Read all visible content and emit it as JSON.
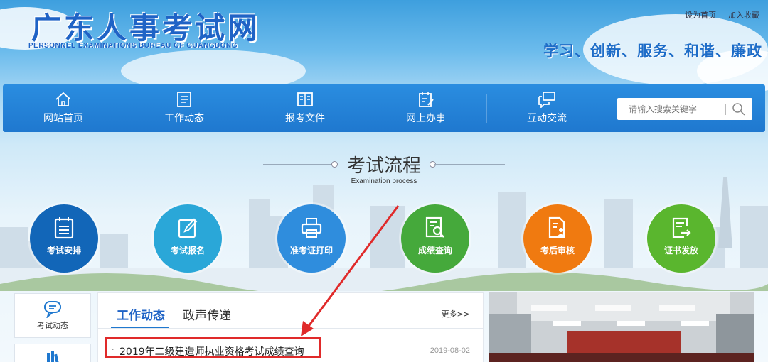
{
  "header": {
    "title": "广东人事考试网",
    "subtitle": "PERSONNEL EXAMINATIONS BUREAU OF GUANGDONG",
    "links": [
      "设为首页",
      "加入收藏"
    ],
    "slogan": "学习、创新、服务、和谐、廉政"
  },
  "nav": {
    "items": [
      {
        "label": "网站首页",
        "icon": "home-icon"
      },
      {
        "label": "工作动态",
        "icon": "document-list-icon"
      },
      {
        "label": "报考文件",
        "icon": "open-book-icon"
      },
      {
        "label": "网上办事",
        "icon": "clipboard-pen-icon"
      },
      {
        "label": "互动交流",
        "icon": "chat-bubbles-icon"
      }
    ],
    "search_placeholder": "请输入搜索关键字"
  },
  "process": {
    "title": "考试流程",
    "subtitle": "Examination process",
    "steps": [
      {
        "label": "考试安排",
        "color": "#1266b8"
      },
      {
        "label": "考试报名",
        "color": "#2aa7d8"
      },
      {
        "label": "准考证打印",
        "color": "#2f8ddd"
      },
      {
        "label": "成绩查询",
        "color": "#45a93b"
      },
      {
        "label": "考后审核",
        "color": "#f07a10"
      },
      {
        "label": "证书发放",
        "color": "#5ab62e"
      }
    ]
  },
  "sidebar": {
    "items": [
      {
        "label": "考试动态",
        "icon": "chat-icon"
      }
    ]
  },
  "news": {
    "tabs": [
      "工作动态",
      "政声传递"
    ],
    "more": "更多>>",
    "items": [
      {
        "title": "2019年二级建造师执业资格考试成绩查询",
        "date": "2019-08-02"
      }
    ],
    "highlight_color": "#e02a2a"
  }
}
